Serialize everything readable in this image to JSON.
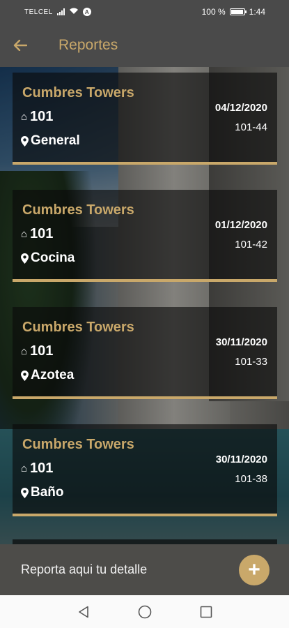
{
  "status_bar": {
    "carrier": "TELCEL",
    "battery_text": "100 %",
    "time": "1:44"
  },
  "header": {
    "title": "Reportes",
    "back_icon": "arrow-left-icon"
  },
  "reports": [
    {
      "building": "Cumbres Towers",
      "unit": "101",
      "area": "General",
      "date": "04/12/2020",
      "code": "101-44"
    },
    {
      "building": "Cumbres Towers",
      "unit": "101",
      "area": "Cocina",
      "date": "01/12/2020",
      "code": "101-42"
    },
    {
      "building": "Cumbres Towers",
      "unit": "101",
      "area": "Azotea",
      "date": "30/11/2020",
      "code": "101-33"
    },
    {
      "building": "Cumbres Towers",
      "unit": "101",
      "area": "Baño",
      "date": "30/11/2020",
      "code": "101-38"
    }
  ],
  "action": {
    "label": "Reporta aqui tu detalle",
    "fab_symbol": "+"
  },
  "colors": {
    "accent": "#c9a86a",
    "bar": "#4a4a4a"
  }
}
